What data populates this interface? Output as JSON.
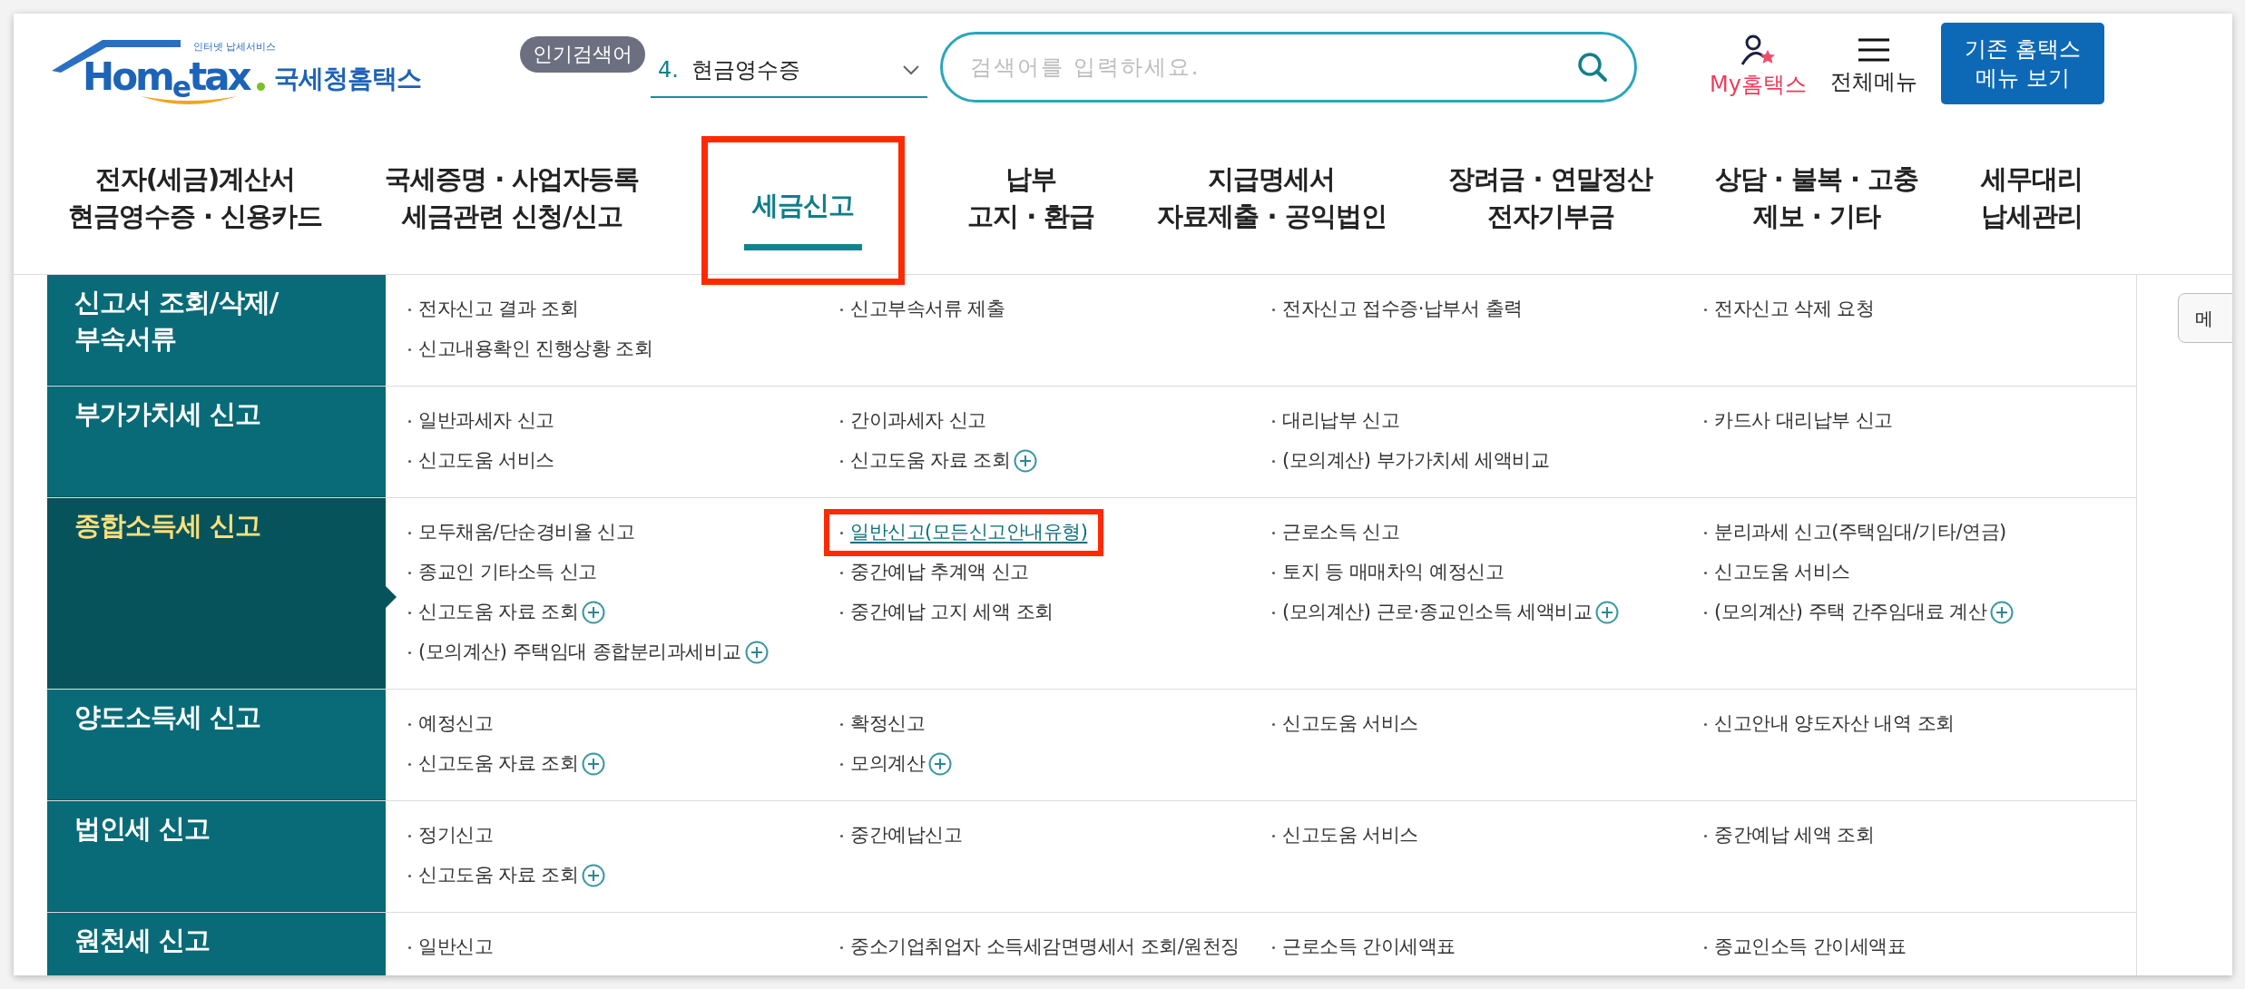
{
  "header": {
    "logo": {
      "tagline": "인터넷 납세서비스",
      "wordmark": "Hom$_{e}$tax",
      "name": "국세청홈택스"
    },
    "popular": {
      "badge": "인기검색어",
      "rank": "4.",
      "term": "현금영수증"
    },
    "search": {
      "placeholder": "검색어를 입력하세요."
    },
    "utilities": [
      {
        "kind": "my",
        "label": "My홈택스"
      },
      {
        "kind": "menu",
        "label": "전체메뉴"
      }
    ],
    "old_menu_button": [
      "기존 홈택스",
      "메뉴 보기"
    ]
  },
  "nav": [
    {
      "lines": [
        "전자(세금)계산서",
        "현금영수증 · 신용카드"
      ],
      "selected": false,
      "highlighted": false
    },
    {
      "lines": [
        "국세증명 · 사업자등록",
        "세금관련 신청/신고"
      ],
      "selected": false,
      "highlighted": false
    },
    {
      "lines": [
        "세금신고"
      ],
      "selected": true,
      "highlighted": true
    },
    {
      "lines": [
        "납부",
        "고지 · 환급"
      ],
      "selected": false,
      "highlighted": false
    },
    {
      "lines": [
        "지급명세서",
        "자료제출 · 공익법인"
      ],
      "selected": false,
      "highlighted": false
    },
    {
      "lines": [
        "장려금 · 연말정산",
        "전자기부금"
      ],
      "selected": false,
      "highlighted": false
    },
    {
      "lines": [
        "상담 · 불복 · 고충",
        "제보 · 기타"
      ],
      "selected": false,
      "highlighted": false
    },
    {
      "lines": [
        "세무대리",
        "납세관리"
      ],
      "selected": false,
      "highlighted": false
    }
  ],
  "sections": [
    {
      "title": "신고서 조회/삭제/\n부속서류",
      "selected": false,
      "items": [
        {
          "label": "전자신고 결과 조회",
          "plus": false,
          "highlighted": false
        },
        {
          "label": "신고부속서류 제출",
          "plus": false,
          "highlighted": false
        },
        {
          "label": "전자신고 접수증·납부서 출력",
          "plus": false,
          "highlighted": false
        },
        {
          "label": "전자신고 삭제 요청",
          "plus": false,
          "highlighted": false
        },
        {
          "label": "신고내용확인 진행상황 조회",
          "plus": false,
          "highlighted": false
        }
      ]
    },
    {
      "title": "부가가치세 신고",
      "selected": false,
      "items": [
        {
          "label": "일반과세자 신고",
          "plus": false,
          "highlighted": false
        },
        {
          "label": "간이과세자 신고",
          "plus": false,
          "highlighted": false
        },
        {
          "label": "대리납부 신고",
          "plus": false,
          "highlighted": false
        },
        {
          "label": "카드사 대리납부 신고",
          "plus": false,
          "highlighted": false
        },
        {
          "label": "신고도움 서비스",
          "plus": false,
          "highlighted": false
        },
        {
          "label": "신고도움 자료 조회",
          "plus": true,
          "highlighted": false
        },
        {
          "label": "(모의계산) 부가가치세 세액비교",
          "plus": false,
          "highlighted": false
        }
      ]
    },
    {
      "title": "종합소득세 신고",
      "selected": true,
      "items": [
        {
          "label": "모두채움/단순경비율 신고",
          "plus": false,
          "highlighted": false
        },
        {
          "label": "일반신고(모든신고안내유형)",
          "plus": false,
          "highlighted": true
        },
        {
          "label": "근로소득 신고",
          "plus": false,
          "highlighted": false
        },
        {
          "label": "분리과세 신고(주택임대/기타/연금)",
          "plus": false,
          "highlighted": false
        },
        {
          "label": "종교인 기타소득 신고",
          "plus": false,
          "highlighted": false
        },
        {
          "label": "중간예납 추계액 신고",
          "plus": false,
          "highlighted": false
        },
        {
          "label": "토지 등 매매차익 예정신고",
          "plus": false,
          "highlighted": false
        },
        {
          "label": "신고도움 서비스",
          "plus": false,
          "highlighted": false
        },
        {
          "label": "신고도움 자료 조회",
          "plus": true,
          "highlighted": false
        },
        {
          "label": "중간예납 고지 세액 조회",
          "plus": false,
          "highlighted": false
        },
        {
          "label": "(모의계산) 근로·종교인소득 세액비교",
          "plus": true,
          "highlighted": false
        },
        {
          "label": "(모의계산) 주택 간주임대료 계산",
          "plus": true,
          "highlighted": false
        },
        {
          "label": "(모의계산) 주택임대 종합분리과세비교",
          "plus": true,
          "highlighted": false
        }
      ]
    },
    {
      "title": "양도소득세 신고",
      "selected": false,
      "items": [
        {
          "label": "예정신고",
          "plus": false,
          "highlighted": false
        },
        {
          "label": "확정신고",
          "plus": false,
          "highlighted": false
        },
        {
          "label": "신고도움 서비스",
          "plus": false,
          "highlighted": false
        },
        {
          "label": "신고안내 양도자산 내역 조회",
          "plus": false,
          "highlighted": false
        },
        {
          "label": "신고도움 자료 조회",
          "plus": true,
          "highlighted": false
        },
        {
          "label": "모의계산",
          "plus": true,
          "highlighted": false
        }
      ]
    },
    {
      "title": "법인세 신고",
      "selected": false,
      "items": [
        {
          "label": "정기신고",
          "plus": false,
          "highlighted": false
        },
        {
          "label": "중간예납신고",
          "plus": false,
          "highlighted": false
        },
        {
          "label": "신고도움 서비스",
          "plus": false,
          "highlighted": false
        },
        {
          "label": "중간예납 세액 조회",
          "plus": false,
          "highlighted": false
        },
        {
          "label": "신고도움 자료 조회",
          "plus": true,
          "highlighted": false
        }
      ]
    },
    {
      "title": "원천세 신고",
      "selected": false,
      "items": [
        {
          "label": "일반신고",
          "plus": false,
          "highlighted": false
        },
        {
          "label": "중소기업취업자 소득세감면명세서 조회/원천징",
          "plus": false,
          "highlighted": false
        },
        {
          "label": "근로소득 간이세액표",
          "plus": false,
          "highlighted": false
        },
        {
          "label": "종교인소득 간이세액표",
          "plus": false,
          "highlighted": false
        }
      ]
    }
  ],
  "side_button": "메"
}
